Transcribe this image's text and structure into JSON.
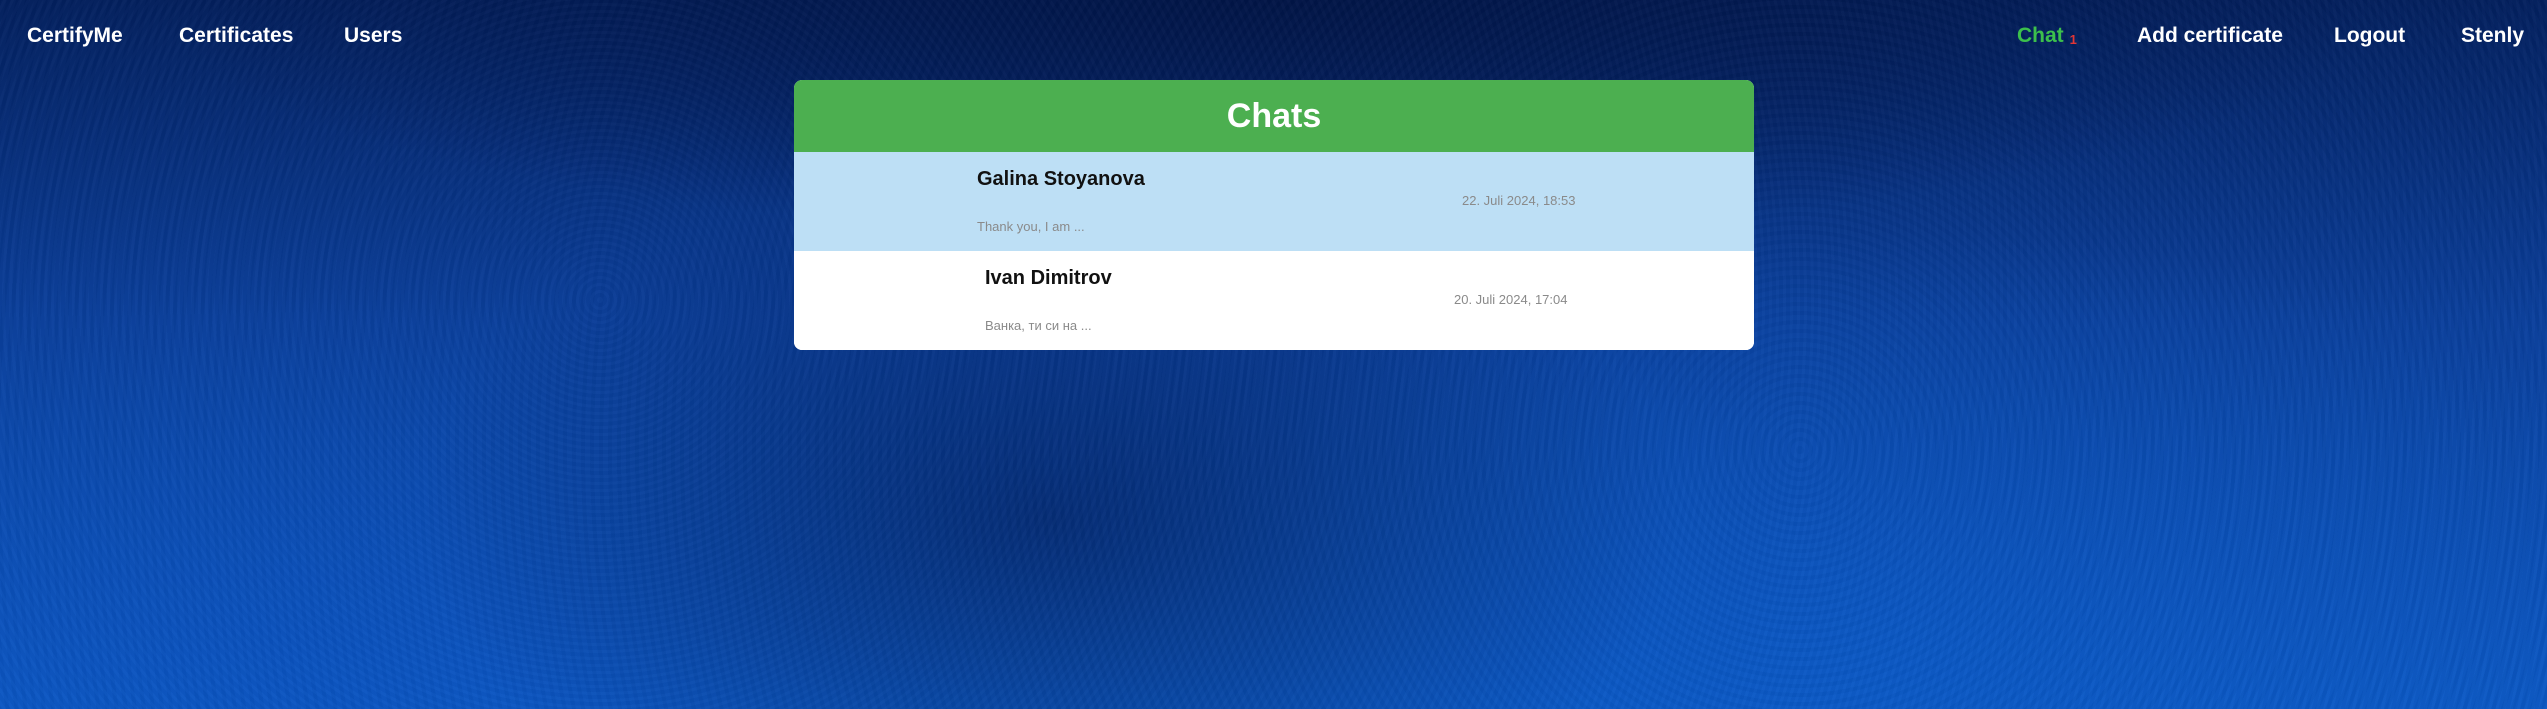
{
  "nav": {
    "brand": "CertifyMe",
    "certificates": "Certificates",
    "users": "Users",
    "chat": "Chat",
    "chat_unread": "1",
    "add_certificate": "Add certificate",
    "logout": "Logout",
    "username": "Stenly"
  },
  "chat_panel": {
    "title": "Chats",
    "items": [
      {
        "name": "Galina Stoyanova",
        "time": "22. Juli 2024, 18:53",
        "preview": "Thank you, I am ..."
      },
      {
        "name": "Ivan Dimitrov",
        "time": "20. Juli 2024, 17:04",
        "preview": "Ванка, ти си на ..."
      }
    ]
  },
  "colors": {
    "header_green": "#4caf50",
    "active_row": "#bddff5",
    "chat_link_green": "#3cc04c",
    "badge_red": "#e23636",
    "background_blue": "#0a3f9c"
  }
}
